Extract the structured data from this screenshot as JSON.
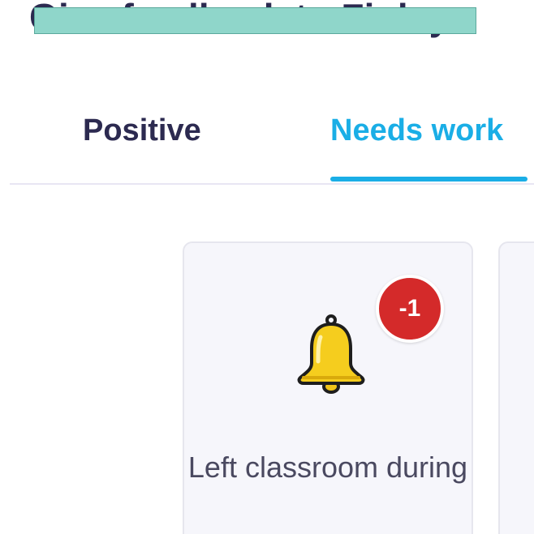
{
  "header": {
    "title": "Give feedback to Finley"
  },
  "tabs": [
    {
      "label": "Positive",
      "active": false
    },
    {
      "label": "Needs work",
      "active": true
    }
  ],
  "colors": {
    "accent": "#1aaee6",
    "heading": "#2c2a50",
    "badge": "#d42a2a",
    "card_bg": "#f6f6fb",
    "redaction": "#8fd6ca"
  },
  "behaviors": [
    {
      "icon": "bell-icon",
      "points": "-1",
      "label": "Left classroom during"
    }
  ]
}
